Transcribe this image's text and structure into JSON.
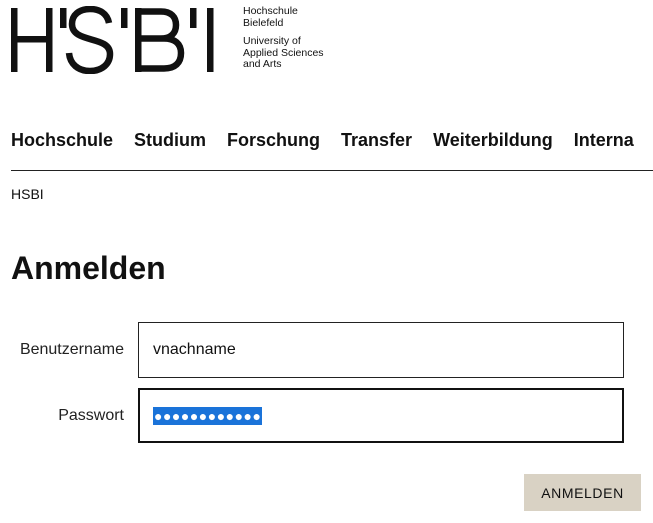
{
  "header": {
    "logo_text": "HS'BI",
    "institution_lines": [
      "Hochschule",
      "Bielefeld"
    ],
    "subtitle_lines": [
      "University of",
      "Applied Sciences",
      "and Arts"
    ]
  },
  "nav": {
    "items": [
      "Hochschule",
      "Studium",
      "Forschung",
      "Transfer",
      "Weiterbildung",
      "Interna"
    ]
  },
  "breadcrumb": "HSBI",
  "page": {
    "title": "Anmelden"
  },
  "form": {
    "username_label": "Benutzername",
    "username_value": "vnachname",
    "password_label": "Passwort",
    "password_masked": "●●●●●●●●●●●●",
    "submit_label": "ANMELDEN"
  },
  "colors": {
    "button_bg": "#d9d2c4",
    "selection": "#1a73d9",
    "text": "#111111"
  }
}
